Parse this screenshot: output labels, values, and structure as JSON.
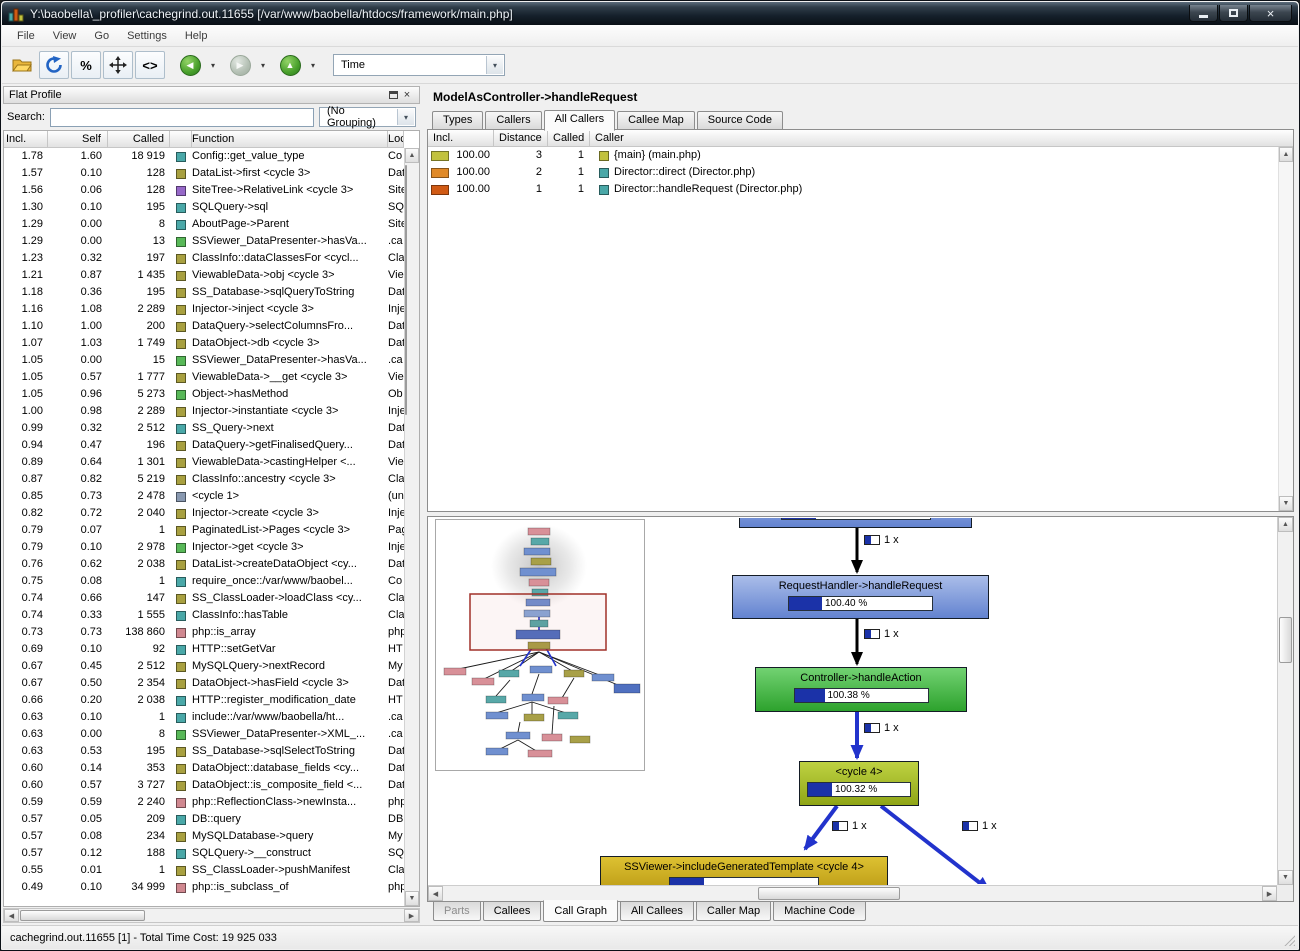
{
  "window": {
    "title": "Y:\\baobella\\_profiler\\cachegrind.out.11655 [/var/www/baobella/htdocs/framework/main.php]",
    "status_text": "cachegrind.out.11655 [1] - Total Time Cost: 19 925 033"
  },
  "menu": {
    "items": [
      "File",
      "View",
      "Go",
      "Settings",
      "Help"
    ]
  },
  "toolbar": {
    "percent": "%",
    "relative": "<>",
    "event_combo": "Time"
  },
  "flat_profile": {
    "title": "Flat Profile",
    "search_label": "Search:",
    "search_value": "",
    "grouping": "(No Grouping)",
    "columns": [
      "Incl.",
      "Self",
      "Called",
      "Function",
      "Loc"
    ],
    "rows": [
      {
        "incl": "1.78",
        "self": "1.60",
        "called": "18 919",
        "fn": "Config::get_value_type",
        "loc": "Co",
        "color": "#4aa8a8"
      },
      {
        "incl": "1.57",
        "self": "0.10",
        "called": "128",
        "fn": "DataList->first <cycle 3>",
        "loc": "Dat",
        "color": "#a8a040"
      },
      {
        "incl": "1.56",
        "self": "0.06",
        "called": "128",
        "fn": "SiteTree->RelativeLink <cycle 3>",
        "loc": "Site",
        "color": "#9668c8"
      },
      {
        "incl": "1.30",
        "self": "0.10",
        "called": "195",
        "fn": "SQLQuery->sql",
        "loc": "SQL",
        "color": "#4aa8a8"
      },
      {
        "incl": "1.29",
        "self": "0.00",
        "called": "8",
        "fn": "AboutPage->Parent",
        "loc": "Site",
        "color": "#4aa8a8"
      },
      {
        "incl": "1.29",
        "self": "0.00",
        "called": "13",
        "fn": "SSViewer_DataPresenter->hasVa...",
        "loc": ".ca",
        "color": "#58b858"
      },
      {
        "incl": "1.23",
        "self": "0.32",
        "called": "197",
        "fn": "ClassInfo::dataClassesFor <cycl...",
        "loc": "Cla",
        "color": "#a8a040"
      },
      {
        "incl": "1.21",
        "self": "0.87",
        "called": "1 435",
        "fn": "ViewableData->obj <cycle 3>",
        "loc": "Vie",
        "color": "#a8a040"
      },
      {
        "incl": "1.18",
        "self": "0.36",
        "called": "195",
        "fn": "SS_Database->sqlQueryToString",
        "loc": "Dat",
        "color": "#a8a040"
      },
      {
        "incl": "1.16",
        "self": "1.08",
        "called": "2 289",
        "fn": "Injector->inject <cycle 3>",
        "loc": "Inje",
        "color": "#a8a040"
      },
      {
        "incl": "1.10",
        "self": "1.00",
        "called": "200",
        "fn": "DataQuery->selectColumnsFro...",
        "loc": "Dat",
        "color": "#a8a040"
      },
      {
        "incl": "1.07",
        "self": "1.03",
        "called": "1 749",
        "fn": "DataObject->db <cycle 3>",
        "loc": "Dat",
        "color": "#a8a040"
      },
      {
        "incl": "1.05",
        "self": "0.00",
        "called": "15",
        "fn": "SSViewer_DataPresenter->hasVa...",
        "loc": ".ca",
        "color": "#58b858"
      },
      {
        "incl": "1.05",
        "self": "0.57",
        "called": "1 777",
        "fn": "ViewableData->__get <cycle 3>",
        "loc": "Vie",
        "color": "#a8a040"
      },
      {
        "incl": "1.05",
        "self": "0.96",
        "called": "5 273",
        "fn": "Object->hasMethod",
        "loc": "Ob",
        "color": "#58b858"
      },
      {
        "incl": "1.00",
        "self": "0.98",
        "called": "2 289",
        "fn": "Injector->instantiate <cycle 3>",
        "loc": "Inje",
        "color": "#a8a040"
      },
      {
        "incl": "0.99",
        "self": "0.32",
        "called": "2 512",
        "fn": "SS_Query->next",
        "loc": "Dat",
        "color": "#4aa8a8"
      },
      {
        "incl": "0.94",
        "self": "0.47",
        "called": "196",
        "fn": "DataQuery->getFinalisedQuery...",
        "loc": "Dat",
        "color": "#a8a040"
      },
      {
        "incl": "0.89",
        "self": "0.64",
        "called": "1 301",
        "fn": "ViewableData->castingHelper <...",
        "loc": "Vie",
        "color": "#a8a040"
      },
      {
        "incl": "0.87",
        "self": "0.82",
        "called": "5 219",
        "fn": "ClassInfo::ancestry <cycle 3>",
        "loc": "Cla",
        "color": "#a8a040"
      },
      {
        "incl": "0.85",
        "self": "0.73",
        "called": "2 478",
        "fn": "<cycle 1>",
        "loc": "(un",
        "color": "#8898b0"
      },
      {
        "incl": "0.82",
        "self": "0.72",
        "called": "2 040",
        "fn": "Injector->create <cycle 3>",
        "loc": "Inje",
        "color": "#a8a040"
      },
      {
        "incl": "0.79",
        "self": "0.07",
        "called": "1",
        "fn": "PaginatedList->Pages <cycle 3>",
        "loc": "Pag",
        "color": "#a8a040"
      },
      {
        "incl": "0.79",
        "self": "0.10",
        "called": "2 978",
        "fn": "Injector->get <cycle 3>",
        "loc": "Inje",
        "color": "#58b858"
      },
      {
        "incl": "0.76",
        "self": "0.62",
        "called": "2 038",
        "fn": "DataList->createDataObject <cy...",
        "loc": "Dat",
        "color": "#a8a040"
      },
      {
        "incl": "0.75",
        "self": "0.08",
        "called": "1",
        "fn": "require_once::/var/www/baobel...",
        "loc": "Co",
        "color": "#4aa8a8"
      },
      {
        "incl": "0.74",
        "self": "0.66",
        "called": "147",
        "fn": "SS_ClassLoader->loadClass <cy...",
        "loc": "Cla",
        "color": "#a8a040"
      },
      {
        "incl": "0.74",
        "self": "0.33",
        "called": "1 555",
        "fn": "ClassInfo::hasTable",
        "loc": "Cla",
        "color": "#4aa8a8"
      },
      {
        "incl": "0.73",
        "self": "0.73",
        "called": "138 860",
        "fn": "php::is_array",
        "loc": "php",
        "color": "#d08890"
      },
      {
        "incl": "0.69",
        "self": "0.10",
        "called": "92",
        "fn": "HTTP::setGetVar",
        "loc": "HT",
        "color": "#4aa8a8"
      },
      {
        "incl": "0.67",
        "self": "0.45",
        "called": "2 512",
        "fn": "MySQLQuery->nextRecord",
        "loc": "My",
        "color": "#a8a040"
      },
      {
        "incl": "0.67",
        "self": "0.50",
        "called": "2 354",
        "fn": "DataObject->hasField <cycle 3>",
        "loc": "Dat",
        "color": "#a8a040"
      },
      {
        "incl": "0.66",
        "self": "0.20",
        "called": "2 038",
        "fn": "HTTP::register_modification_date",
        "loc": "HT",
        "color": "#4aa8a8"
      },
      {
        "incl": "0.63",
        "self": "0.10",
        "called": "1",
        "fn": "include::/var/www/baobella/ht...",
        "loc": ".ca",
        "color": "#4aa8a8"
      },
      {
        "incl": "0.63",
        "self": "0.00",
        "called": "8",
        "fn": "SSViewer_DataPresenter->XML_...",
        "loc": ".ca",
        "color": "#58b858"
      },
      {
        "incl": "0.63",
        "self": "0.53",
        "called": "195",
        "fn": "SS_Database->sqlSelectToString",
        "loc": "Dat",
        "color": "#a8a040"
      },
      {
        "incl": "0.60",
        "self": "0.14",
        "called": "353",
        "fn": "DataObject::database_fields <cy...",
        "loc": "Dat",
        "color": "#a8a040"
      },
      {
        "incl": "0.60",
        "self": "0.57",
        "called": "3 727",
        "fn": "DataObject::is_composite_field <...",
        "loc": "Dat",
        "color": "#a8a040"
      },
      {
        "incl": "0.59",
        "self": "0.59",
        "called": "2 240",
        "fn": "php::ReflectionClass->newInsta...",
        "loc": "php",
        "color": "#d08890"
      },
      {
        "incl": "0.57",
        "self": "0.05",
        "called": "209",
        "fn": "DB::query",
        "loc": "DB.",
        "color": "#4aa8a8"
      },
      {
        "incl": "0.57",
        "self": "0.08",
        "called": "234",
        "fn": "MySQLDatabase->query",
        "loc": "My",
        "color": "#a8a040"
      },
      {
        "incl": "0.57",
        "self": "0.12",
        "called": "188",
        "fn": "SQLQuery->__construct",
        "loc": "SQ",
        "color": "#4aa8a8"
      },
      {
        "incl": "0.55",
        "self": "0.01",
        "called": "1",
        "fn": "SS_ClassLoader->pushManifest",
        "loc": "Cla",
        "color": "#a8a040"
      },
      {
        "incl": "0.49",
        "self": "0.10",
        "called": "34 999",
        "fn": "php::is_subclass_of",
        "loc": "php",
        "color": "#d08890"
      }
    ]
  },
  "function_pane": {
    "title": "ModelAsController->handleRequest",
    "tabs": [
      {
        "label": "Types"
      },
      {
        "label": "Callers"
      },
      {
        "label": "All Callers",
        "active": true
      },
      {
        "label": "Callee Map"
      },
      {
        "label": "Source Code"
      }
    ],
    "columns": [
      "Incl.",
      "Distance",
      "Called",
      "Caller"
    ],
    "rows": [
      {
        "incl": "100.00",
        "distance": "3",
        "called": "1",
        "caller": "{main} (main.php)",
        "bar_color": "#c2c23e",
        "icon_color": "#c2c23e"
      },
      {
        "incl": "100.00",
        "distance": "2",
        "called": "1",
        "caller": "Director::direct (Director.php)",
        "bar_color": "#e08a28",
        "icon_color": "#4aa8a8"
      },
      {
        "incl": "100.00",
        "distance": "1",
        "called": "1",
        "caller": "Director::handleRequest (Director.php)",
        "bar_color": "#d05a14",
        "icon_color": "#4aa8a8"
      }
    ]
  },
  "graph": {
    "edge_label": "1 x",
    "nodes": {
      "requesthandler": {
        "label": "RequestHandler->handleRequest",
        "pct": "100.40 %"
      },
      "controller": {
        "label": "Controller->handleAction",
        "pct": "100.38 %"
      },
      "cycle4": {
        "label": "<cycle 4>",
        "pct": "100.32 %"
      },
      "ssviewer": {
        "label": "SSViewer->includeGeneratedTemplate <cycle 4>"
      }
    },
    "tabs": [
      {
        "label": "Parts",
        "disabled": true
      },
      {
        "label": "Callees"
      },
      {
        "label": "Call Graph",
        "active": true
      },
      {
        "label": "All Callees"
      },
      {
        "label": "Caller Map"
      },
      {
        "label": "Machine Code"
      }
    ]
  }
}
